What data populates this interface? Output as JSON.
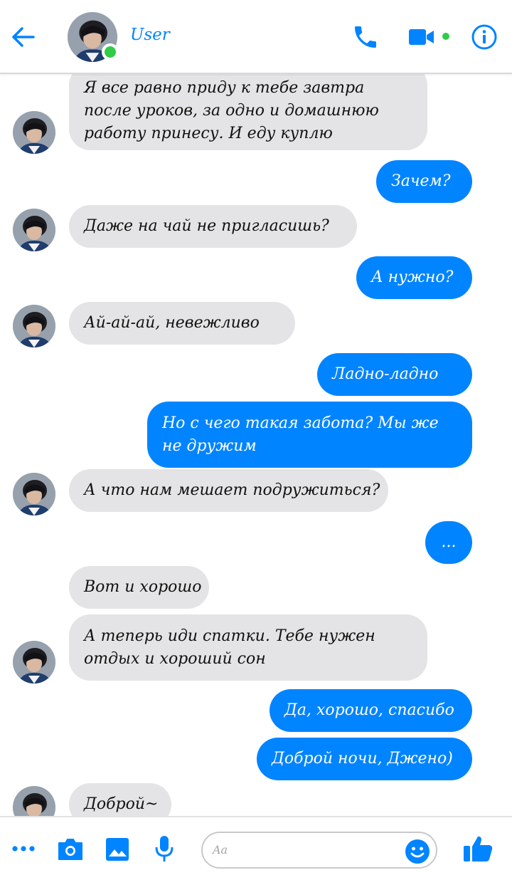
{
  "header": {
    "contact_name": "User",
    "online": true,
    "accent": "#0084ff",
    "online_color": "#31cc46",
    "icons": [
      "back-arrow-icon",
      "phone-icon",
      "video-camera-icon",
      "info-icon"
    ]
  },
  "messages": [
    {
      "side": "in",
      "text": "Я все равно приду к тебе завтра после уроков, за одно и домашнюю работу принесу. И еду куплю"
    },
    {
      "side": "out",
      "text": "Зачем?"
    },
    {
      "side": "in",
      "text": "Даже на чай не пригласишь?"
    },
    {
      "side": "out",
      "text": "А нужно?"
    },
    {
      "side": "in",
      "text": "Ай-ай-ай, невежливо"
    },
    {
      "side": "out",
      "text": "Ладно-ладно"
    },
    {
      "side": "out",
      "text": "Но с чего такая забота? Мы же не дружим"
    },
    {
      "side": "in",
      "text": "А что нам мешает подружиться?"
    },
    {
      "side": "out",
      "text": "..."
    },
    {
      "side": "in",
      "text": "Вот и хорошо"
    },
    {
      "side": "in",
      "text": "А теперь иди спатки. Тебе нужен отдых и хороший сон"
    },
    {
      "side": "out",
      "text": "Да, хорошо, спасибо"
    },
    {
      "side": "out",
      "text": "Доброй ночи, Джено)"
    },
    {
      "side": "in",
      "text": "Доброй~"
    }
  ],
  "composer": {
    "placeholder": "Aa",
    "icons": [
      "more-icon",
      "camera-icon",
      "image-icon",
      "microphone-icon",
      "emoji-icon",
      "like-icon"
    ]
  },
  "colors": {
    "incoming_bubble": "#e4e4e6",
    "outgoing_bubble": "#0084ff"
  }
}
